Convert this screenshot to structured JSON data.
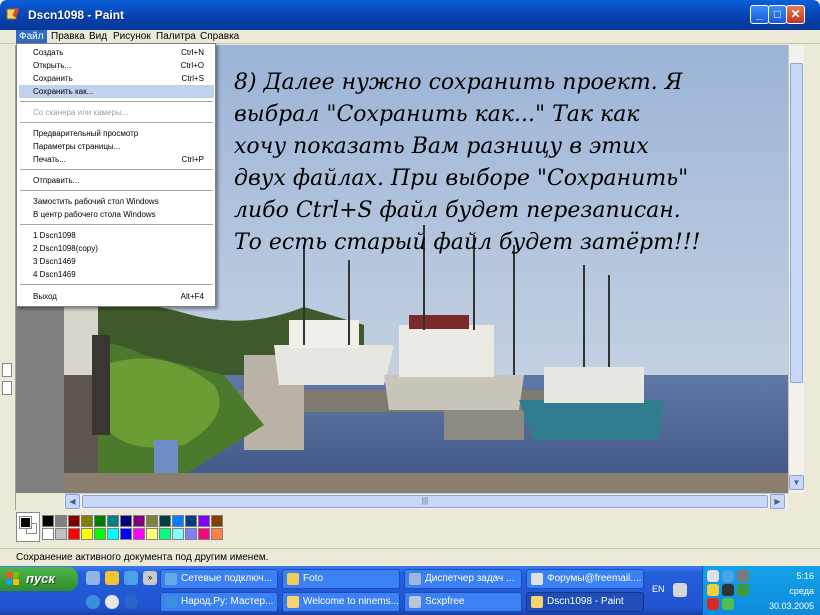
{
  "window": {
    "title": "Dscn1098 - Paint",
    "controls": {
      "minimize": "_",
      "maximize": "□",
      "close": "✕"
    }
  },
  "menubar": {
    "items": [
      "Файл",
      "Правка",
      "Вид",
      "Рисунок",
      "Палитра",
      "Справка"
    ],
    "active": "Файл"
  },
  "file_menu": {
    "items": [
      {
        "label": "Создать",
        "shortcut": "Ctrl+N"
      },
      {
        "label": "Открыть...",
        "shortcut": "Ctrl+O"
      },
      {
        "label": "Сохранить",
        "shortcut": "Ctrl+S"
      },
      {
        "label": "Сохранить как...",
        "shortcut": "",
        "highlighted": true
      },
      {
        "label": "Со сканера или камеры...",
        "shortcut": "",
        "disabled": true
      },
      {
        "label": "Предварительный просмотр",
        "shortcut": ""
      },
      {
        "label": "Параметры страницы...",
        "shortcut": ""
      },
      {
        "label": "Печать...",
        "shortcut": "Ctrl+P"
      },
      {
        "label": "Отправить...",
        "shortcut": ""
      },
      {
        "label": "Замостить рабочий стол Windows",
        "shortcut": ""
      },
      {
        "label": "В центр рабочего стола Windows",
        "shortcut": ""
      },
      {
        "label": "1 Dscn1098",
        "shortcut": ""
      },
      {
        "label": "2 Dscn1098(copy)",
        "shortcut": ""
      },
      {
        "label": "3 Dscn1469",
        "shortcut": ""
      },
      {
        "label": "4 Dscn1469",
        "shortcut": ""
      },
      {
        "label": "Выход",
        "shortcut": "Alt+F4"
      }
    ]
  },
  "canvas": {
    "caption_lines": [
      "8) Далее нужно сохранить проект. Я",
      "выбрал \"Сохранить как...\" Так как",
      "хочу показать Вам разницу в этих",
      "двух файлах. При выборе \"Сохранить\"",
      "либо Ctrl+S файл будет перезаписан.",
      "То есть старый файл будет затёрт!!!"
    ]
  },
  "palette": {
    "colors_top": [
      "#000000",
      "#808080",
      "#800000",
      "#808000",
      "#008000",
      "#008080",
      "#000080",
      "#800080",
      "#808040",
      "#004040",
      "#0080ff",
      "#004080",
      "#8000ff",
      "#804000"
    ],
    "colors_bottom": [
      "#ffffff",
      "#c0c0c0",
      "#ff0000",
      "#ffff00",
      "#00ff00",
      "#00ffff",
      "#0000ff",
      "#ff00ff",
      "#ffff80",
      "#00ff80",
      "#80ffff",
      "#8080ff",
      "#ff0080",
      "#ff8040"
    ]
  },
  "statusbar": {
    "text": "Сохранение активного документа под другим именем."
  },
  "taskbar": {
    "start_label": "пуск",
    "row1": [
      "Сетевые подключ...",
      "Foto",
      "Диспетчер задач ...",
      "Форумы@freemail...."
    ],
    "row2": [
      "Народ.Ру: Мастер...",
      "Welcome to ninems...",
      "Scxpfree",
      "Dscn1098 - Paint"
    ],
    "active_task": "Dscn1098 - Paint",
    "language": "EN",
    "clock": {
      "time": "5:16",
      "day": "среда",
      "date": "30.03.2005"
    }
  }
}
